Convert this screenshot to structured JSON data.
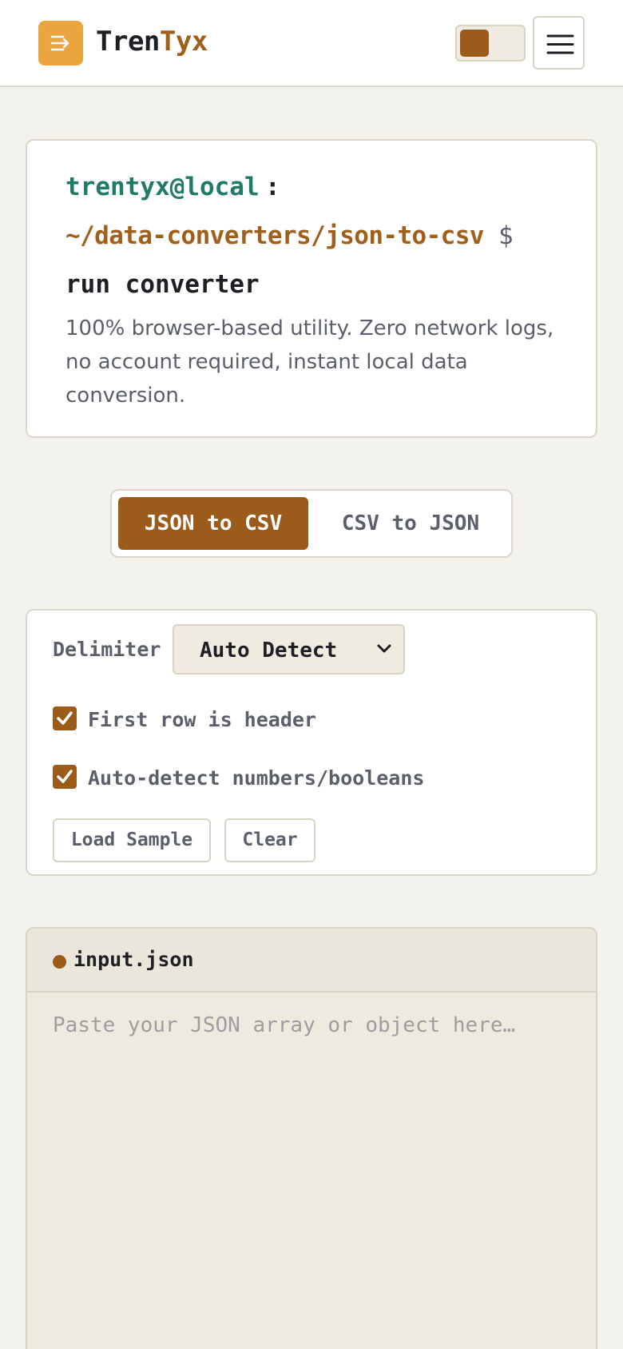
{
  "header": {
    "brand_part1": "Tren",
    "brand_part2": "Tyx",
    "logo_icon": "sort-lines-icon",
    "theme_toggle_icon": "theme-toggle",
    "menu_icon": "hamburger-menu-icon"
  },
  "terminal": {
    "user": "trentyx@local",
    "colon": ":",
    "path": "~/data-converters/json-to-csv",
    "dollar": "$",
    "command": "run converter",
    "description": "100% browser-based utility. Zero network logs, no account required, instant local data conversion."
  },
  "mode": {
    "json_to_csv": "JSON to CSV",
    "csv_to_json": "CSV to JSON",
    "active": "JSON to CSV"
  },
  "options": {
    "delimiter_label": "Delimiter",
    "delimiter_value": "Auto Detect",
    "first_row_header_label": "First row is header",
    "first_row_header_checked": true,
    "auto_detect_label": "Auto-detect numbers/booleans",
    "auto_detect_checked": true,
    "load_sample_label": "Load Sample",
    "clear_label": "Clear"
  },
  "input": {
    "file_name": "input.json",
    "placeholder": "Paste your JSON array or object here…"
  },
  "colors": {
    "accent": "#9b5b1b",
    "logo_orange": "#eba53f",
    "terminal_green": "#1f7a66",
    "path_brown": "#a0601c"
  }
}
